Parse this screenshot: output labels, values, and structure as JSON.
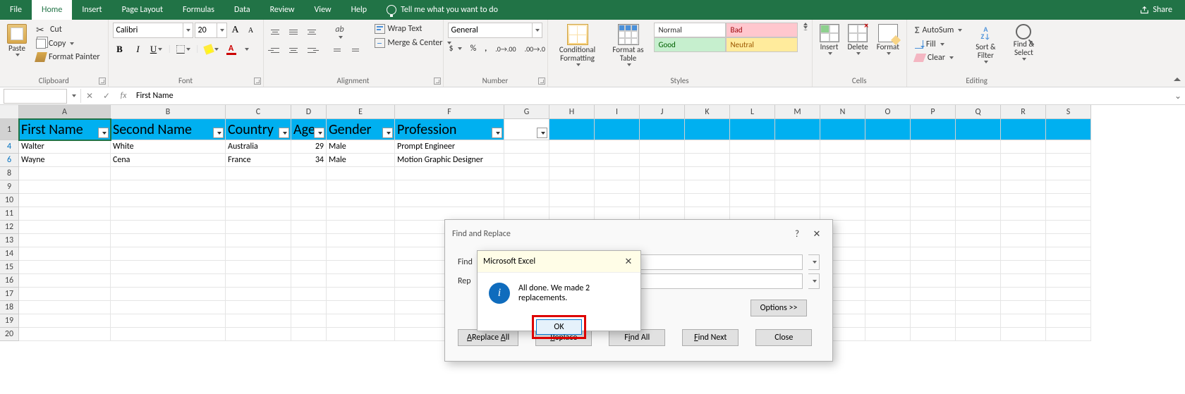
{
  "tabs": {
    "file": "File",
    "home": "Home",
    "insert": "Insert",
    "pageLayout": "Page Layout",
    "formulas": "Formulas",
    "data": "Data",
    "review": "Review",
    "view": "View",
    "help": "Help",
    "tellMe": "Tell me what you want to do",
    "share": "Share"
  },
  "ribbon": {
    "clipboard": {
      "label": "Clipboard",
      "paste": "Paste",
      "cut": "Cut",
      "copy": "Copy",
      "formatPainter": "Format Painter"
    },
    "font": {
      "label": "Font",
      "name": "Calibri",
      "size": "20"
    },
    "alignment": {
      "label": "Alignment",
      "wrap": "Wrap Text",
      "merge": "Merge & Center"
    },
    "number": {
      "label": "Number",
      "format": "General"
    },
    "styles": {
      "label": "Styles",
      "cond": "Conditional Formatting",
      "asTable": "Format as Table",
      "normal": "Normal",
      "bad": "Bad",
      "good": "Good",
      "neutral": "Neutral"
    },
    "cells": {
      "label": "Cells",
      "insert": "Insert",
      "delete": "Delete",
      "format": "Format"
    },
    "editing": {
      "label": "Editing",
      "autosum": "AutoSum",
      "fill": "Fill",
      "clear": "Clear",
      "sort": "Sort & Filter",
      "find": "Find & Select"
    }
  },
  "formulaBar": {
    "value": "First Name"
  },
  "columns": [
    "A",
    "B",
    "C",
    "D",
    "E",
    "F",
    "G",
    "H",
    "I",
    "J",
    "K",
    "L",
    "M",
    "N",
    "O",
    "P",
    "Q",
    "R",
    "S"
  ],
  "headerRow": {
    "rownum": "1",
    "cells": [
      "First Name",
      "Second Name",
      "Country",
      "Age",
      "Gender",
      "Profession"
    ]
  },
  "dataRows": [
    {
      "rownum": "4",
      "cells": [
        "Walter",
        "White",
        "Australia",
        "29",
        "Male",
        "Prompt Engineer"
      ]
    },
    {
      "rownum": "6",
      "cells": [
        "Wayne",
        "Cena",
        "France",
        "34",
        "Male",
        "Motion Graphic Designer"
      ]
    }
  ],
  "emptyRows": [
    "8",
    "9",
    "10",
    "11",
    "12",
    "13",
    "14",
    "15",
    "16",
    "17",
    "18",
    "19",
    "20"
  ],
  "findDialog": {
    "title": "Find and Replace",
    "findLabel": "Find",
    "replaceLabel": "Rep",
    "options": "Options >>",
    "replaceAll": "Replace All",
    "replace": "Replace",
    "findAll": "Find All",
    "findNext": "Find Next",
    "close": "Close"
  },
  "msgDialog": {
    "title": "Microsoft Excel",
    "text": "All done. We made 2 replacements.",
    "ok": "OK"
  }
}
